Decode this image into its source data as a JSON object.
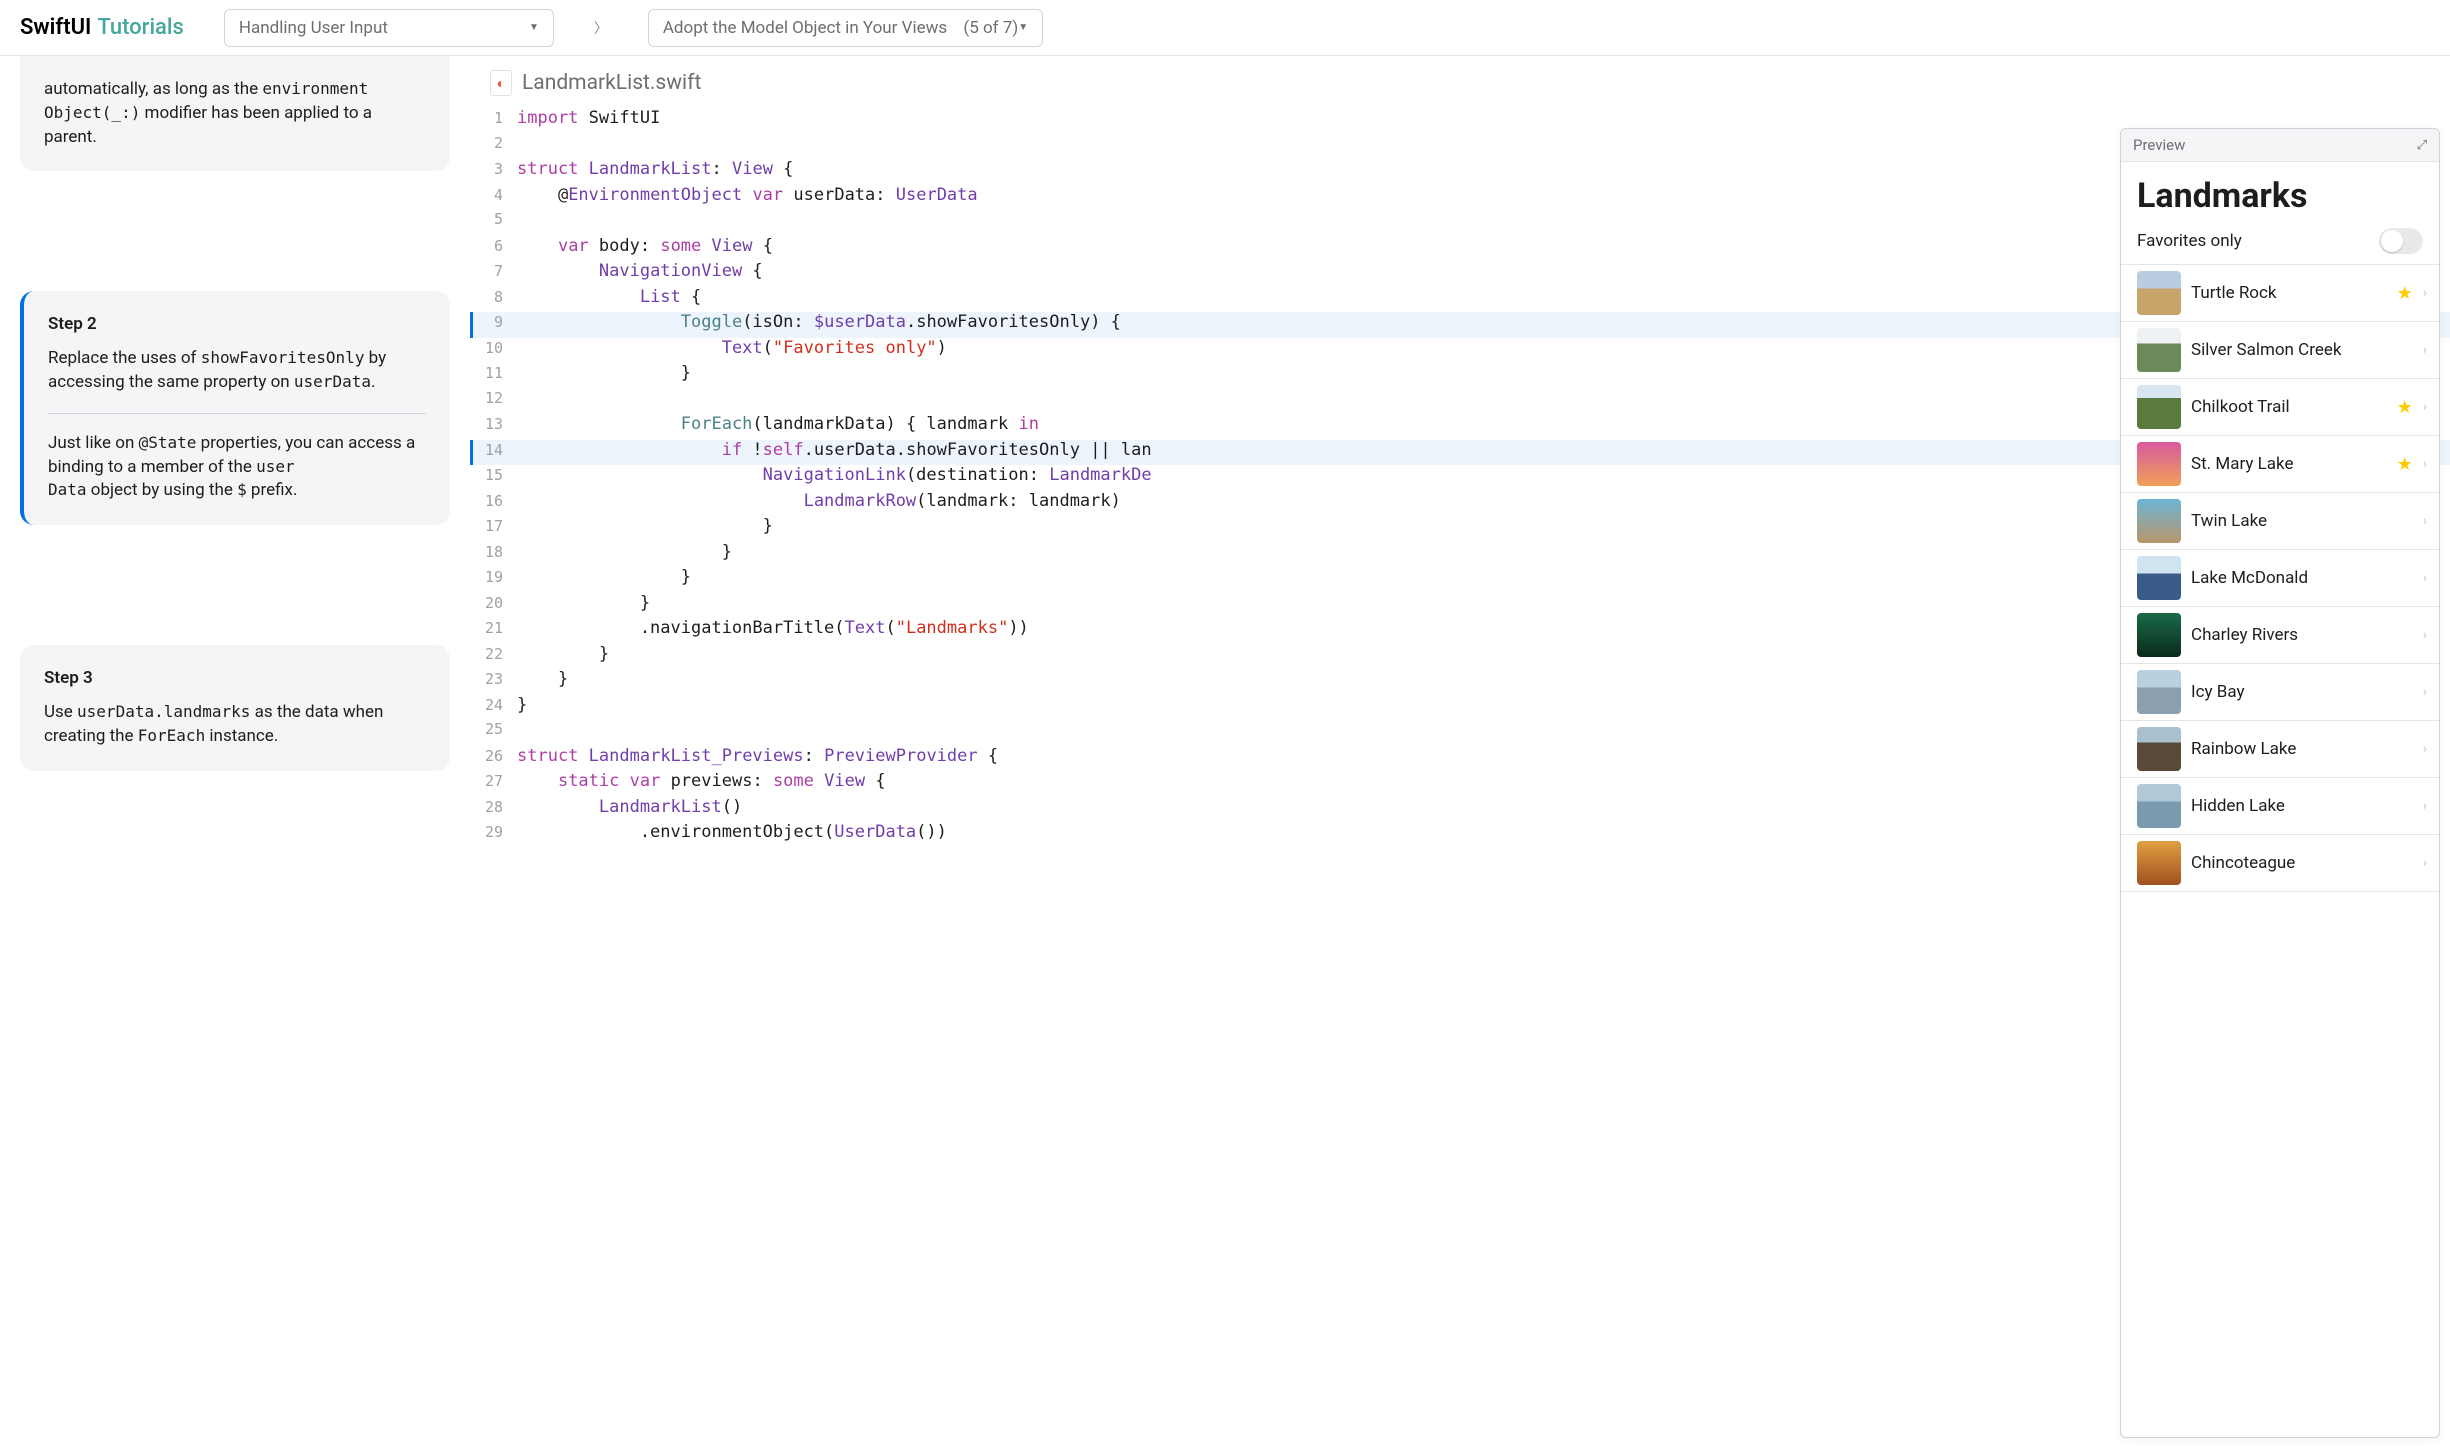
{
  "header": {
    "logo_main": "SwiftUI",
    "logo_sub": "Tutorials",
    "dropdown_left": "Handling User Input",
    "dropdown_right": "Adopt the Model Object in Your Views",
    "dropdown_count": "(5 of 7)"
  },
  "steps": {
    "partial_text_a": "automatically, as long as the ",
    "partial_code_a": "environment",
    "partial_code_b": "Object(_:)",
    "partial_text_b": " modifier has been applied to a parent.",
    "step2_title": "Step 2",
    "step2_p1_a": "Replace the uses of ",
    "step2_p1_code": "showFavoritesOnly",
    "step2_p1_b": " by accessing the same property on ",
    "step2_p1_code2": "userData",
    "step2_p1_c": ".",
    "step2_p2_a": "Just like on ",
    "step2_p2_code1": "@State",
    "step2_p2_b": " properties, you can access a binding to a member of the ",
    "step2_p2_code2": "user",
    "step2_p2_code3": "Data",
    "step2_p2_c": " object by using the ",
    "step2_p2_code4": "$",
    "step2_p2_d": " prefix.",
    "step3_title": "Step 3",
    "step3_p1_a": "Use ",
    "step3_p1_code": "userData.landmarks",
    "step3_p1_b": " as the data when creating the ",
    "step3_p1_code2": "ForEach",
    "step3_p1_c": " instance."
  },
  "file": {
    "name": "LandmarkList.swift",
    "icon_glyph": "🐦"
  },
  "code_lines": [
    {
      "n": 1,
      "hl": false,
      "tokens": [
        [
          "kw",
          "import"
        ],
        [
          "id",
          " SwiftUI"
        ]
      ]
    },
    {
      "n": 2,
      "hl": false,
      "tokens": []
    },
    {
      "n": 3,
      "hl": false,
      "tokens": [
        [
          "kw",
          "struct"
        ],
        [
          "id",
          " "
        ],
        [
          "ty",
          "LandmarkList"
        ],
        [
          "id",
          ": "
        ],
        [
          "ty",
          "View"
        ],
        [
          "id",
          " {"
        ]
      ]
    },
    {
      "n": 4,
      "hl": false,
      "tokens": [
        [
          "id",
          "    @"
        ],
        [
          "ty",
          "EnvironmentObject"
        ],
        [
          "id",
          " "
        ],
        [
          "kw",
          "var"
        ],
        [
          "id",
          " userData: "
        ],
        [
          "ty",
          "UserData"
        ]
      ]
    },
    {
      "n": 5,
      "hl": false,
      "tokens": []
    },
    {
      "n": 6,
      "hl": false,
      "tokens": [
        [
          "id",
          "    "
        ],
        [
          "kw",
          "var"
        ],
        [
          "id",
          " body: "
        ],
        [
          "kw",
          "some"
        ],
        [
          "id",
          " "
        ],
        [
          "ty",
          "View"
        ],
        [
          "id",
          " {"
        ]
      ]
    },
    {
      "n": 7,
      "hl": false,
      "tokens": [
        [
          "id",
          "        "
        ],
        [
          "ty",
          "NavigationView"
        ],
        [
          "id",
          " {"
        ]
      ]
    },
    {
      "n": 8,
      "hl": false,
      "tokens": [
        [
          "id",
          "            "
        ],
        [
          "ty",
          "List"
        ],
        [
          "id",
          " {"
        ]
      ]
    },
    {
      "n": 9,
      "hl": true,
      "tokens": [
        [
          "id",
          "                "
        ],
        [
          "fn",
          "Toggle"
        ],
        [
          "id",
          "(isOn: "
        ],
        [
          "ty",
          "$userData"
        ],
        [
          "id",
          ".showFavoritesOnly) {"
        ]
      ]
    },
    {
      "n": 10,
      "hl": false,
      "tokens": [
        [
          "id",
          "                    "
        ],
        [
          "ty",
          "Text"
        ],
        [
          "id",
          "("
        ],
        [
          "str",
          "\"Favorites only\""
        ],
        [
          "id",
          ")"
        ]
      ]
    },
    {
      "n": 11,
      "hl": false,
      "tokens": [
        [
          "id",
          "                }"
        ]
      ]
    },
    {
      "n": 12,
      "hl": false,
      "tokens": []
    },
    {
      "n": 13,
      "hl": false,
      "tokens": [
        [
          "id",
          "                "
        ],
        [
          "fn",
          "ForEach"
        ],
        [
          "id",
          "(landmarkData) { landmark "
        ],
        [
          "kw",
          "in"
        ]
      ]
    },
    {
      "n": 14,
      "hl": true,
      "tokens": [
        [
          "id",
          "                    "
        ],
        [
          "kw",
          "if"
        ],
        [
          "id",
          " !"
        ],
        [
          "kw",
          "self"
        ],
        [
          "id",
          ".userData.showFavoritesOnly || lan"
        ]
      ]
    },
    {
      "n": 15,
      "hl": false,
      "tokens": [
        [
          "id",
          "                        "
        ],
        [
          "ty",
          "NavigationLink"
        ],
        [
          "id",
          "(destination: "
        ],
        [
          "ty",
          "LandmarkDe"
        ]
      ]
    },
    {
      "n": 16,
      "hl": false,
      "tokens": [
        [
          "id",
          "                            "
        ],
        [
          "ty",
          "LandmarkRow"
        ],
        [
          "id",
          "(landmark: landmark)"
        ]
      ]
    },
    {
      "n": 17,
      "hl": false,
      "tokens": [
        [
          "id",
          "                        }"
        ]
      ]
    },
    {
      "n": 18,
      "hl": false,
      "tokens": [
        [
          "id",
          "                    }"
        ]
      ]
    },
    {
      "n": 19,
      "hl": false,
      "tokens": [
        [
          "id",
          "                }"
        ]
      ]
    },
    {
      "n": 20,
      "hl": false,
      "tokens": [
        [
          "id",
          "            }"
        ]
      ]
    },
    {
      "n": 21,
      "hl": false,
      "tokens": [
        [
          "id",
          "            .navigationBarTitle("
        ],
        [
          "ty",
          "Text"
        ],
        [
          "id",
          "("
        ],
        [
          "str",
          "\"Landmarks\""
        ],
        [
          "id",
          "))"
        ]
      ]
    },
    {
      "n": 22,
      "hl": false,
      "tokens": [
        [
          "id",
          "        }"
        ]
      ]
    },
    {
      "n": 23,
      "hl": false,
      "tokens": [
        [
          "id",
          "    }"
        ]
      ]
    },
    {
      "n": 24,
      "hl": false,
      "tokens": [
        [
          "id",
          "}"
        ]
      ]
    },
    {
      "n": 25,
      "hl": false,
      "tokens": []
    },
    {
      "n": 26,
      "hl": false,
      "tokens": [
        [
          "kw",
          "struct"
        ],
        [
          "id",
          " "
        ],
        [
          "ty",
          "LandmarkList_Previews"
        ],
        [
          "id",
          ": "
        ],
        [
          "ty",
          "PreviewProvider"
        ],
        [
          "id",
          " {"
        ]
      ]
    },
    {
      "n": 27,
      "hl": false,
      "tokens": [
        [
          "id",
          "    "
        ],
        [
          "kw",
          "static"
        ],
        [
          "id",
          " "
        ],
        [
          "kw",
          "var"
        ],
        [
          "id",
          " previews: "
        ],
        [
          "kw",
          "some"
        ],
        [
          "id",
          " "
        ],
        [
          "ty",
          "View"
        ],
        [
          "id",
          " {"
        ]
      ]
    },
    {
      "n": 28,
      "hl": false,
      "tokens": [
        [
          "id",
          "        "
        ],
        [
          "ty",
          "LandmarkList"
        ],
        [
          "id",
          "()"
        ]
      ]
    },
    {
      "n": 29,
      "hl": false,
      "tokens": [
        [
          "id",
          "            .environmentObject("
        ],
        [
          "ty",
          "UserData"
        ],
        [
          "id",
          "())"
        ]
      ]
    }
  ],
  "preview": {
    "header": "Preview",
    "title": "Landmarks",
    "fav_label": "Favorites only",
    "items": [
      {
        "name": "Turtle Rock",
        "fav": true
      },
      {
        "name": "Silver Salmon Creek",
        "fav": false
      },
      {
        "name": "Chilkoot Trail",
        "fav": true
      },
      {
        "name": "St. Mary Lake",
        "fav": true
      },
      {
        "name": "Twin Lake",
        "fav": false
      },
      {
        "name": "Lake McDonald",
        "fav": false
      },
      {
        "name": "Charley Rivers",
        "fav": false
      },
      {
        "name": "Icy Bay",
        "fav": false
      },
      {
        "name": "Rainbow Lake",
        "fav": false
      },
      {
        "name": "Hidden Lake",
        "fav": false
      },
      {
        "name": "Chincoteague",
        "fav": false
      }
    ]
  }
}
